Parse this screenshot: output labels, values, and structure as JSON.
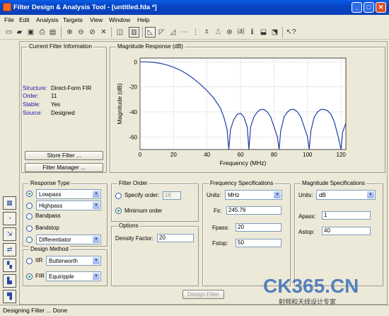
{
  "window": {
    "title": "Filter Design & Analysis Tool - [untitled.fda *]"
  },
  "menu": [
    "File",
    "Edit",
    "Analysis",
    "Targets",
    "View",
    "Window",
    "Help"
  ],
  "toolbar_icons": [
    "new-icon",
    "open-icon",
    "save-icon",
    "print-icon",
    "print-preview-icon",
    "zoom-in-icon",
    "zoom-out-icon",
    "zoom-x-icon",
    "full-view-icon",
    "new-fig-icon",
    "filter-specs-icon",
    "magnitude-icon",
    "phase-icon",
    "mag-phase-icon",
    "group-delay-icon",
    "phase-delay-icon",
    "impulse-icon",
    "step-icon",
    "pole-zero-icon",
    "coefficients-icon",
    "info-icon",
    "round-off-icon",
    "export-icon",
    "whats-this-icon"
  ],
  "current_filter": {
    "title": "Current Filter Information",
    "rows": [
      {
        "key": "Structure:",
        "value": "Direct-Form FIR"
      },
      {
        "key": "Order:",
        "value": "11"
      },
      {
        "key": "Stable:",
        "value": "Yes"
      },
      {
        "key": "Source:",
        "value": "Designed"
      }
    ],
    "store_button": "Store Filter ...",
    "manager_button": "Filter Manager ..."
  },
  "chart_data": {
    "type": "line",
    "title": "Magnitude Response (dB)",
    "xlabel": "Frequency (MHz)",
    "ylabel": "Magnitude (dB)",
    "xlim": [
      0,
      122.88
    ],
    "ylim": [
      -70,
      3
    ],
    "xticks": [
      0,
      20,
      40,
      60,
      80,
      100,
      120
    ],
    "yticks": [
      0,
      -20,
      -40,
      -60
    ],
    "grid": true,
    "series": [
      {
        "color": "#1f3fa8",
        "x": [
          0,
          4,
          8,
          12,
          16,
          20,
          24,
          28,
          32,
          36,
          40,
          44,
          48,
          50,
          52,
          53,
          54,
          56,
          58,
          60,
          62,
          64,
          65,
          66,
          68,
          70,
          72,
          74,
          76,
          78,
          80,
          82,
          83,
          84,
          86,
          88,
          90,
          92,
          94,
          96,
          98,
          100,
          101,
          102,
          104,
          106,
          108,
          110,
          112,
          114,
          116,
          118,
          120,
          121,
          122.88
        ],
        "y": [
          0,
          0,
          -0.4,
          -1.2,
          -2.5,
          -4.3,
          -6.6,
          -9.7,
          -13.5,
          -18,
          -23,
          -29,
          -37,
          -44,
          -54,
          -70,
          -54,
          -46,
          -42,
          -41,
          -44,
          -52,
          -70,
          -52,
          -44,
          -40,
          -38,
          -38,
          -40,
          -44,
          -52,
          -60,
          -70,
          -55,
          -44,
          -40,
          -38,
          -38,
          -40,
          -44,
          -52,
          -60,
          -70,
          -55,
          -44,
          -40,
          -38,
          -38,
          -39,
          -42,
          -48,
          -58,
          -70,
          -56,
          -49
        ]
      }
    ]
  },
  "response_type": {
    "title": "Response Type",
    "options": [
      {
        "label": "Lowpass",
        "selected": true,
        "combo": true
      },
      {
        "label": "Highpass",
        "selected": false,
        "combo": true
      },
      {
        "label": "Bandpass",
        "selected": false,
        "combo": false
      },
      {
        "label": "Bandstop",
        "selected": false,
        "combo": false
      },
      {
        "label": "Differentiator",
        "selected": false,
        "combo": true
      }
    ]
  },
  "design_method": {
    "title": "Design Method",
    "iir_label": "IIR",
    "iir_value": "Butterworth",
    "fir_label": "FIR",
    "fir_value": "Equiripple"
  },
  "filter_order": {
    "title": "Filter Order",
    "specify_label": "Specify order:",
    "specify_value": "16",
    "minimum_label": "Minimum order"
  },
  "options": {
    "title": "Options",
    "density_label": "Density Factor:",
    "density_value": "20"
  },
  "frequency_specs": {
    "title": "Frequency Specifications",
    "units_label": "Units:",
    "units_value": "MHz",
    "fs_label": "Fs:",
    "fs_value": "245.76",
    "fpass_label": "Fpass:",
    "fpass_value": "20",
    "fstop_label": "Fstop:",
    "fstop_value": "50"
  },
  "magnitude_specs": {
    "title": "Magnitude Specifications",
    "units_label": "Units:",
    "units_value": "dB",
    "apass_label": "Apass:",
    "apass_value": "1",
    "astop_label": "Astop:",
    "astop_value": "40"
  },
  "design_button": "Design Filter",
  "status": "Designing Filter ... Done",
  "watermark": {
    "main": "CK365.CN",
    "sub": "射频和天线设计专家"
  }
}
